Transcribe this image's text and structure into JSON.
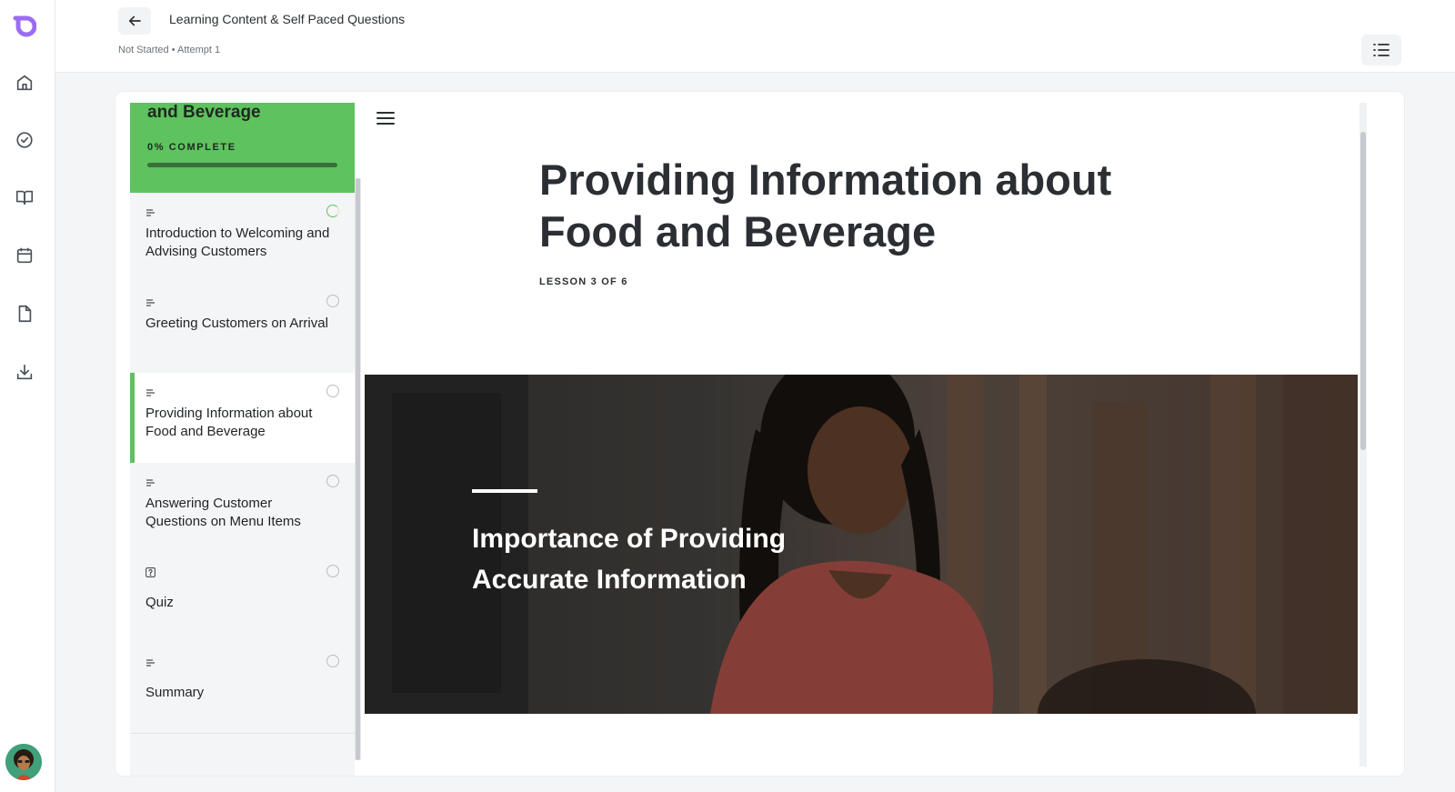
{
  "header": {
    "title": "Learning Content & Self Paced Questions",
    "status": "Not Started • Attempt 1"
  },
  "rail": {
    "items": [
      "home-icon",
      "check-badge-icon",
      "book-icon",
      "calendar-icon",
      "document-icon",
      "download-icon"
    ]
  },
  "course": {
    "title": "and Beverage",
    "progress_label": "0% COMPLETE",
    "progress_fraction": 0
  },
  "lessons": [
    {
      "label": "Introduction to Welcoming and Advising Customers",
      "type": "text-icon",
      "status": "in-progress"
    },
    {
      "label": "Greeting Customers on Arrival",
      "type": "text-icon",
      "status": "not-started"
    },
    {
      "label": "Providing Information about Food and Beverage",
      "type": "text-icon",
      "status": "not-started",
      "active": true
    },
    {
      "label": "Answering Customer Questions on Menu Items",
      "type": "text-icon",
      "status": "not-started"
    },
    {
      "label": "Quiz",
      "type": "quiz-icon",
      "status": "not-started"
    },
    {
      "label": "Summary",
      "type": "text-icon",
      "status": "not-started"
    }
  ],
  "content": {
    "heading": "Providing Information about Food and Beverage",
    "lesson_count": "LESSON 3 OF 6",
    "hero_heading": "Importance of Providing Accurate Information"
  },
  "colors": {
    "accent": "#5ec25f",
    "text": "#2b2f33",
    "logo": "#8b5cf6"
  }
}
